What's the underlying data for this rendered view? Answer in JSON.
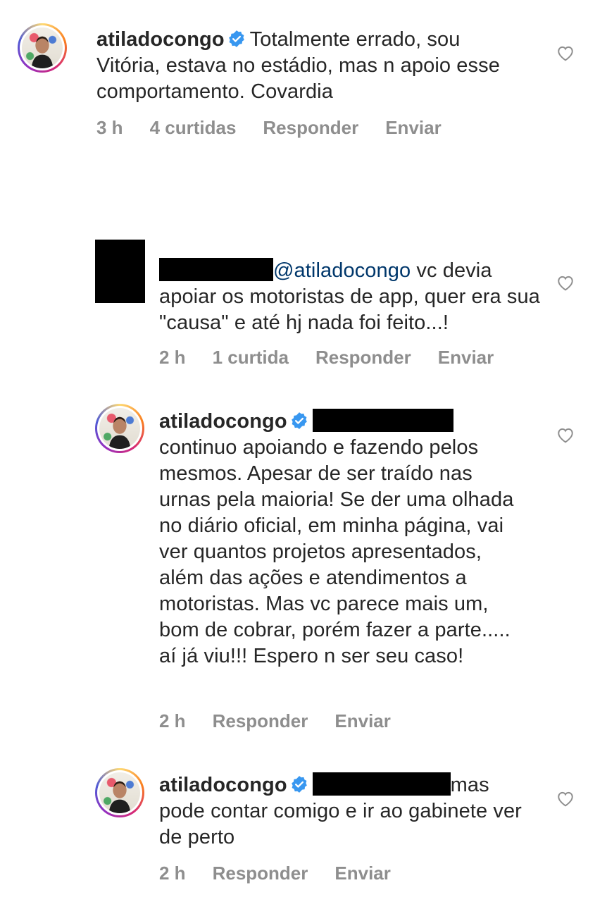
{
  "comments": [
    {
      "username": "atiladocongo",
      "text": "Totalmente errado, sou Vitória, estava no estádio, mas n apoio esse comportamento. Covardia",
      "time": "3 h",
      "likes": "4 curtidas",
      "reply_label": "Responder",
      "send_label": "Enviar"
    },
    {
      "mention": "@atiladocongo",
      "text_first": " vc devia",
      "text_rest": "apoiar os motoristas de app, quer era sua \"causa\" e até hj nada foi feito...!",
      "time": "2 h",
      "likes": "1 curtida",
      "reply_label": "Responder",
      "send_label": "Enviar"
    },
    {
      "username": "atiladocongo",
      "text": "continuo apoiando e fazendo pelos mesmos. Apesar de ser traído nas urnas pela maioria! Se der uma olhada no diário oficial, em minha página, vai ver quantos projetos apresentados, além das ações e atendimentos a motoristas. Mas vc parece mais um, bom de cobrar, porém fazer a parte..... aí já viu!!! Espero n ser seu caso!",
      "time": "2 h",
      "reply_label": "Responder",
      "send_label": "Enviar"
    },
    {
      "username": "atiladocongo",
      "text_first": "mas",
      "text_rest": "pode contar comigo e ir ao gabinete ver de perto",
      "time": "2 h",
      "reply_label": "Responder",
      "send_label": "Enviar"
    }
  ],
  "colors": {
    "text": "#262626",
    "meta": "#8e8e8e",
    "mention": "#00376b",
    "verified": "#3897f0"
  },
  "icons": [
    "heart-outline-icon",
    "verified-badge-icon"
  ]
}
